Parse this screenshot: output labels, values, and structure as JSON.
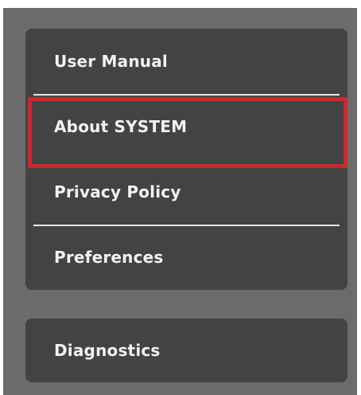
{
  "menu": {
    "items": [
      {
        "label": "User Manual"
      },
      {
        "label": "About SYSTEM"
      },
      {
        "label": "Privacy Policy"
      },
      {
        "label": "Preferences"
      }
    ],
    "highlighted_index": 1,
    "highlight_color": "#d0262c"
  },
  "secondary_menu": {
    "items": [
      {
        "label": "Diagnostics"
      }
    ]
  },
  "colors": {
    "background": "#6b6b6b",
    "panel": "#434343",
    "text": "#f2f2f2",
    "divider": "#e6e6e6"
  }
}
